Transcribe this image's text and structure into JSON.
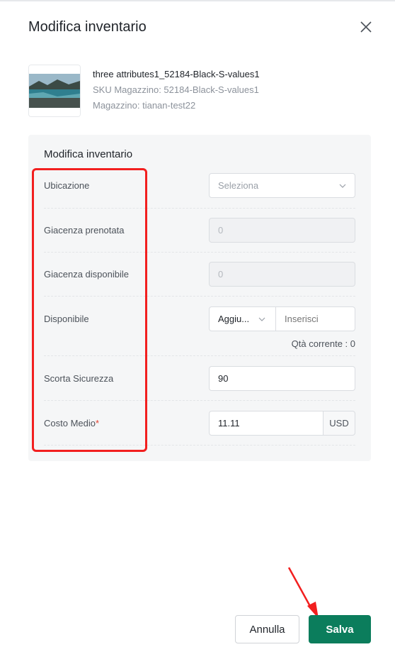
{
  "dialog": {
    "title": "Modifica inventario"
  },
  "product": {
    "name": "three attributes1_52184-Black-S-values1",
    "sku_line": "SKU Magazzino: 52184-Black-S-values1",
    "warehouse_line": "Magazzino: tianan-test22"
  },
  "form": {
    "section_title": "Modifica inventario",
    "location": {
      "label": "Ubicazione",
      "placeholder": "Seleziona"
    },
    "reserved": {
      "label": "Giacenza prenotata",
      "value": "0"
    },
    "available_stock": {
      "label": "Giacenza disponibile",
      "value": "0"
    },
    "available": {
      "label": "Disponibile",
      "mode": "Aggiu...",
      "input_placeholder": "Inserisci",
      "current_qty": "Qtà corrente : 0"
    },
    "safety_stock": {
      "label": "Scorta Sicurezza",
      "value": "90"
    },
    "avg_cost": {
      "label": "Costo Medio",
      "required_mark": "*",
      "value": "11.11",
      "currency": "USD"
    }
  },
  "footer": {
    "cancel_label": "Annulla",
    "save_label": "Salva"
  },
  "colors": {
    "accent": "#0b7d5c",
    "annotation": "#f21f1f"
  }
}
